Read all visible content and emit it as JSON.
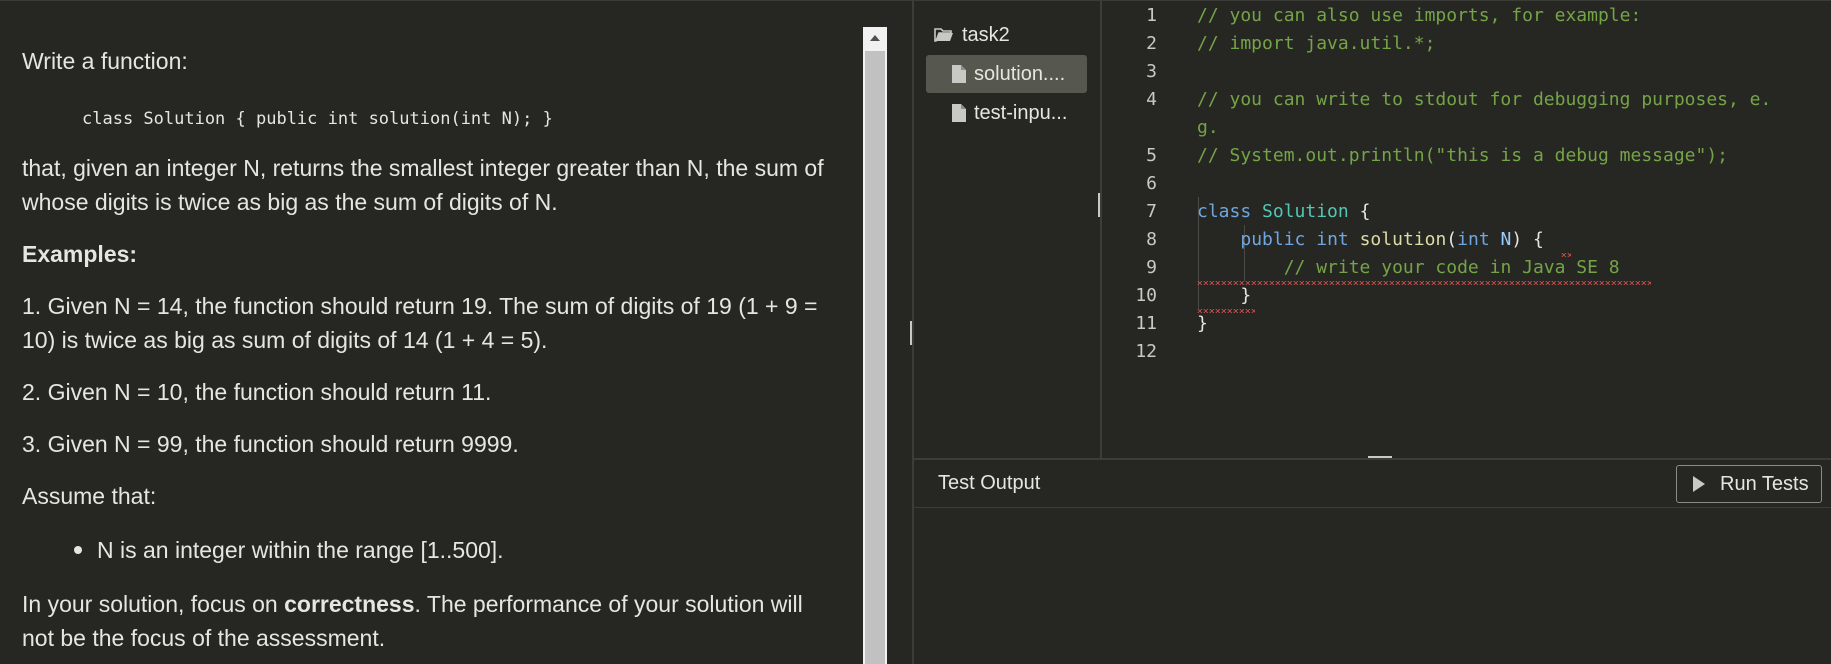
{
  "task": {
    "intro": "Write a function:",
    "signature": "class Solution { public int solution(int N); }",
    "description_line1": "that, given an integer N, returns the smallest integer greater than N, the sum of",
    "description_line2": "whose digits is twice as big as the sum of digits of N.",
    "examples_heading": "Examples:",
    "example1_line1": "1. Given N = 14, the function should return 19. The sum of digits of 19 (1 + 9 =",
    "example1_line2": "10) is twice as big as sum of digits of 14 (1 + 4 = 5).",
    "example2": "2. Given N = 10, the function should return 11.",
    "example3": "3. Given N = 99, the function should return 9999.",
    "assume_heading": "Assume that:",
    "assumption1": "N is an integer within the range [1..500].",
    "focus_prefix": "In your solution, focus on ",
    "focus_bold": "correctness",
    "focus_suffix": ". The performance of your solution will",
    "focus_line2": "not be the focus of the assessment."
  },
  "file_tree": {
    "folder": "task2",
    "files": [
      {
        "label": "solution....",
        "selected": true
      },
      {
        "label": "test-inpu...",
        "selected": false
      }
    ]
  },
  "editor": {
    "line_numbers": [
      "1",
      "2",
      "3",
      "4",
      "5",
      "6",
      "7",
      "8",
      "9",
      "10",
      "11",
      "12"
    ],
    "lines": {
      "l1": "// you can also use imports, for example:",
      "l2": "// import java.util.*;",
      "l4a": "// you can write to stdout for debugging purposes, e.",
      "l4b": "g.",
      "l5": "// System.out.println(\"this is a debug message\");",
      "l7_kw": "class",
      "l7_name": "Solution",
      "l7_brace": "{",
      "l8_public": "public",
      "l8_int": "int",
      "l8_fn": "solution",
      "l8_paren": "(",
      "l8_int2": "int",
      "l8_param": "N",
      "l8_close": ") {",
      "l9": "// write your code in Java SE 8",
      "l10": "}",
      "l11": "}"
    }
  },
  "output": {
    "title": "Test Output",
    "run_button": "Run Tests"
  },
  "colors": {
    "background": "#262723",
    "comment": "#75a448",
    "keyword": "#6fa6e0",
    "class_name": "#54c6b4",
    "function_name": "#dcdca6",
    "error_squiggle": "#e05555"
  }
}
